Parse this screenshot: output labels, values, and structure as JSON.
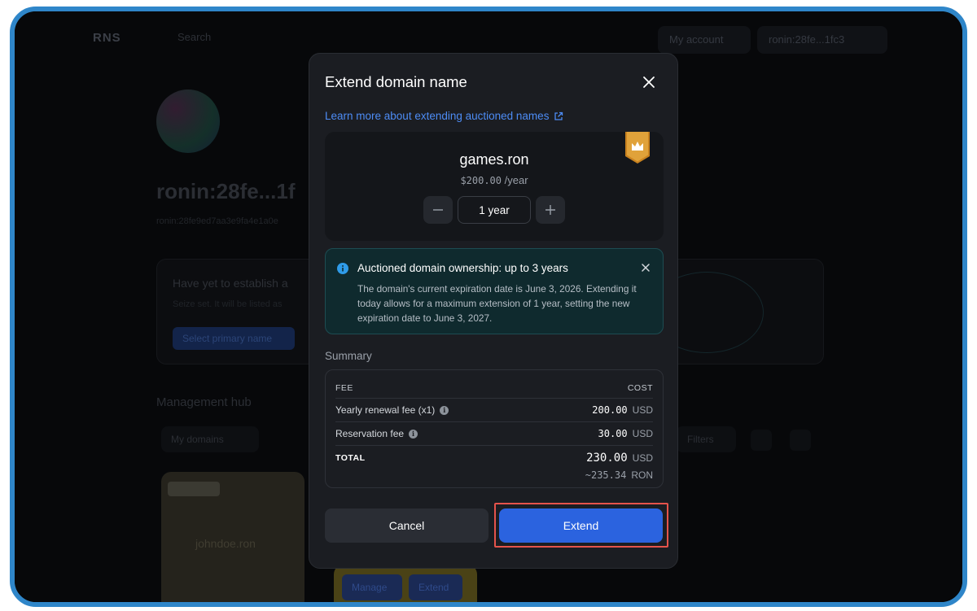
{
  "background": {
    "logo": "RNS",
    "search_placeholder": "Search",
    "my_account": "My account",
    "wallet": "ronin:28fe...1fc3",
    "profile_name": "ronin:28fe...1f",
    "profile_address": "ronin:28fe9ed7aa3e9fa4e1a0e",
    "card_title": "Have yet to establish a",
    "card_sub": "Seize set. It will be listed as",
    "card_button": "Select primary name",
    "management_hub": "Management hub",
    "my_domains_filter": "My domains",
    "filters": "Filters",
    "domain_card_name": "johndoe.ron",
    "manage": "Manage",
    "extend": "Extend"
  },
  "modal": {
    "title": "Extend domain name",
    "learn_more": "Learn more about extending auctioned names",
    "domain": {
      "name": "games.ron",
      "price": "$200.00",
      "price_unit": "/year",
      "duration": "1 year"
    },
    "info": {
      "title": "Auctioned domain ownership: up to 3 years",
      "body": "The domain's current expiration date is June 3, 2026. Extending it today allows for a maximum extension of 1 year, setting the new expiration date to June 3, 2027."
    },
    "summary": {
      "label": "Summary",
      "col_fee": "FEE",
      "col_cost": "COST",
      "rows": [
        {
          "label": "Yearly renewal fee (x1)",
          "value": "200.00",
          "unit": "USD"
        },
        {
          "label": "Reservation fee",
          "value": "30.00",
          "unit": "USD"
        }
      ],
      "total_label": "TOTAL",
      "total_value": "230.00",
      "total_unit": "USD",
      "total_ron": "~235.34",
      "total_ron_unit": "RON"
    },
    "cancel_label": "Cancel",
    "extend_label": "Extend"
  },
  "colors": {
    "accent": "#2b63df",
    "link": "#4d8cf5",
    "highlight": "#e5534b",
    "frame": "#2f86c9"
  }
}
